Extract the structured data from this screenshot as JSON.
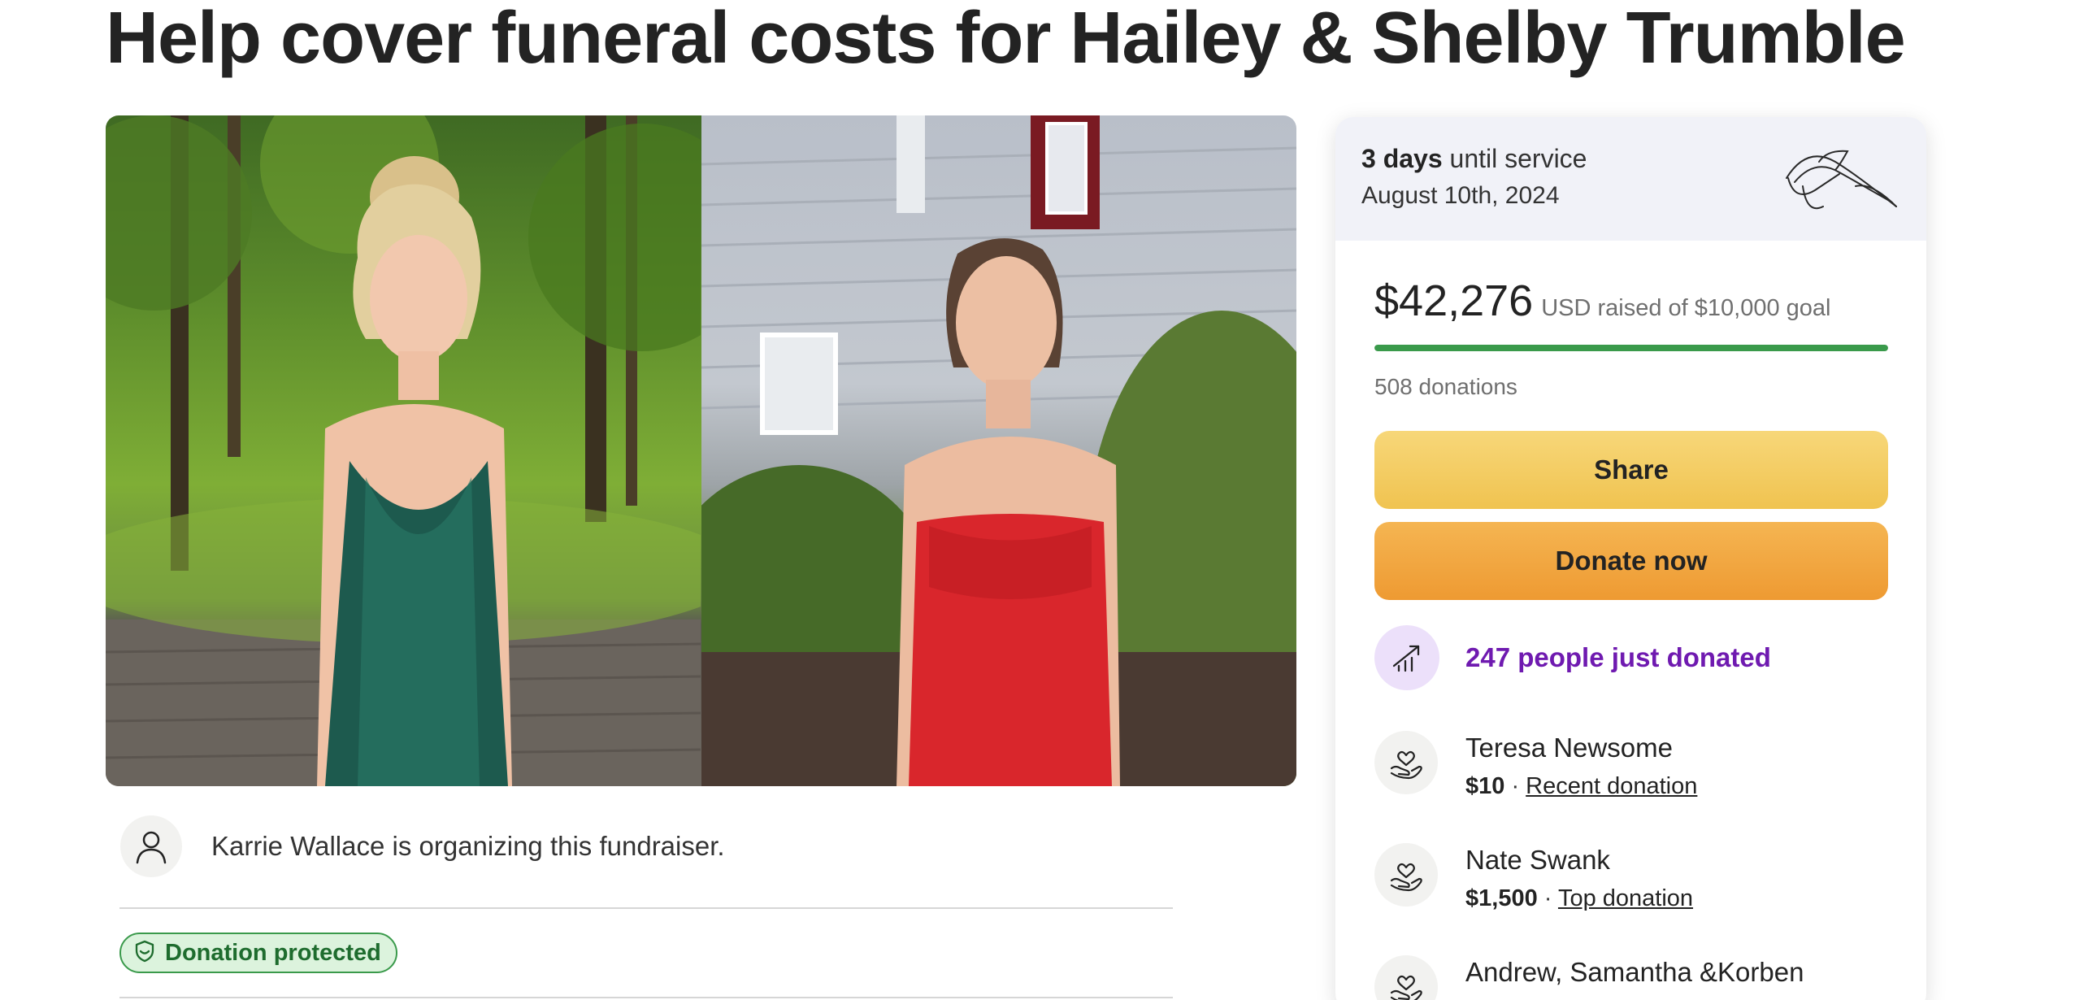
{
  "title": "Help cover funeral costs for Hailey & Shelby Trumble",
  "organizer": {
    "text": "Karrie Wallace is organizing this fundraiser."
  },
  "badge": {
    "label": "Donation protected"
  },
  "service": {
    "days_bold": "3 days",
    "days_rest": " until service",
    "date": "August 10th, 2024"
  },
  "funds": {
    "raised": "$42,276",
    "rest": "USD raised of $10,000 goal",
    "progress_fraction": 1.0,
    "donations": "508 donations"
  },
  "buttons": {
    "share": "Share",
    "donate": "Donate now"
  },
  "trend": {
    "text": "247 people just donated"
  },
  "donors": [
    {
      "name": "Teresa Newsome",
      "amount": "$10",
      "sep": " · ",
      "tag": "Recent donation"
    },
    {
      "name": "Nate Swank",
      "amount": "$1,500",
      "sep": " · ",
      "tag": "Top donation"
    },
    {
      "name": "Andrew, Samantha &Korben"
    }
  ],
  "colors": {
    "progress": "#3a9a4b",
    "trend_text": "#6f1ab0",
    "share_button": "#f0c350",
    "donate_button": "#ee9a32",
    "badge_border": "#3a9a4b"
  },
  "icons": {
    "organizer": "user-icon",
    "badge": "shield-icon",
    "trend": "trending-up-icon",
    "donor": "heart-hand-icon",
    "header": "lily-flower-icon"
  }
}
